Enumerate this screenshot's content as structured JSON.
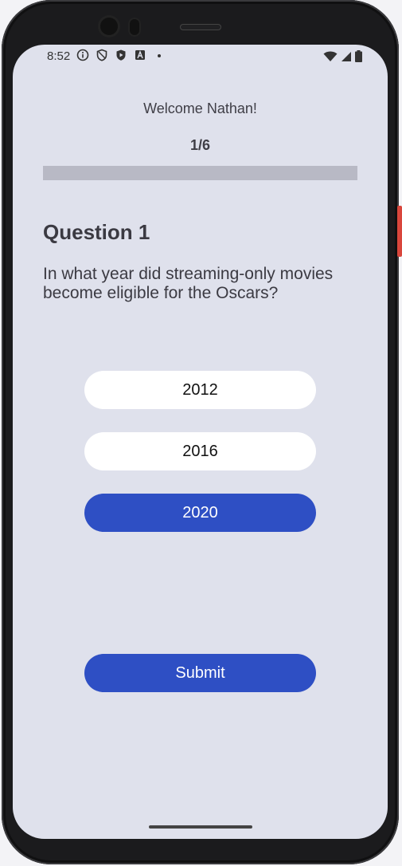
{
  "status_bar": {
    "time": "8:52",
    "left_icons": [
      "info-icon",
      "shield-icon",
      "play-shield-icon",
      "a-icon",
      "dot-icon"
    ],
    "right_icons": [
      "wifi-icon",
      "signal-icon",
      "battery-icon"
    ]
  },
  "header": {
    "welcome": "Welcome Nathan!",
    "counter": "1/6",
    "progress_fraction": 0.0
  },
  "question": {
    "title": "Question 1",
    "text": "In what year did streaming-only movies become eligible for the Oscars?"
  },
  "options": [
    {
      "label": "2012",
      "selected": false
    },
    {
      "label": "2016",
      "selected": false
    },
    {
      "label": "2020",
      "selected": true
    }
  ],
  "actions": {
    "submit_label": "Submit"
  },
  "colors": {
    "accent": "#2e4fc4",
    "screen_bg": "#dfe1ec",
    "progress_track": "#b8b9c5"
  }
}
